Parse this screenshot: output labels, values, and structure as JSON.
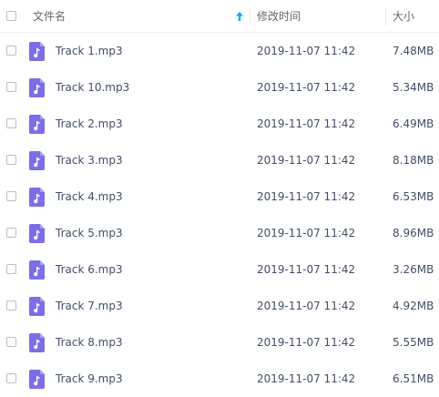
{
  "header": {
    "name_label": "文件名",
    "modified_label": "修改时间",
    "size_label": "大小",
    "sort_direction": "ascending",
    "sort_arrow_color": "#09aaff"
  },
  "file_icon": {
    "name": "music-file-icon",
    "color": "#7c6ee6"
  },
  "files": [
    {
      "name": "Track 1.mp3",
      "modified": "2019-11-07 11:42",
      "size": "7.48MB"
    },
    {
      "name": "Track 10.mp3",
      "modified": "2019-11-07 11:42",
      "size": "5.34MB"
    },
    {
      "name": "Track 2.mp3",
      "modified": "2019-11-07 11:42",
      "size": "6.49MB"
    },
    {
      "name": "Track 3.mp3",
      "modified": "2019-11-07 11:42",
      "size": "8.18MB"
    },
    {
      "name": "Track 4.mp3",
      "modified": "2019-11-07 11:42",
      "size": "6.53MB"
    },
    {
      "name": "Track 5.mp3",
      "modified": "2019-11-07 11:42",
      "size": "8.96MB"
    },
    {
      "name": "Track 6.mp3",
      "modified": "2019-11-07 11:42",
      "size": "3.26MB"
    },
    {
      "name": "Track 7.mp3",
      "modified": "2019-11-07 11:42",
      "size": "4.92MB"
    },
    {
      "name": "Track 8.mp3",
      "modified": "2019-11-07 11:42",
      "size": "5.55MB"
    },
    {
      "name": "Track 9.mp3",
      "modified": "2019-11-07 11:42",
      "size": "6.51MB"
    }
  ]
}
